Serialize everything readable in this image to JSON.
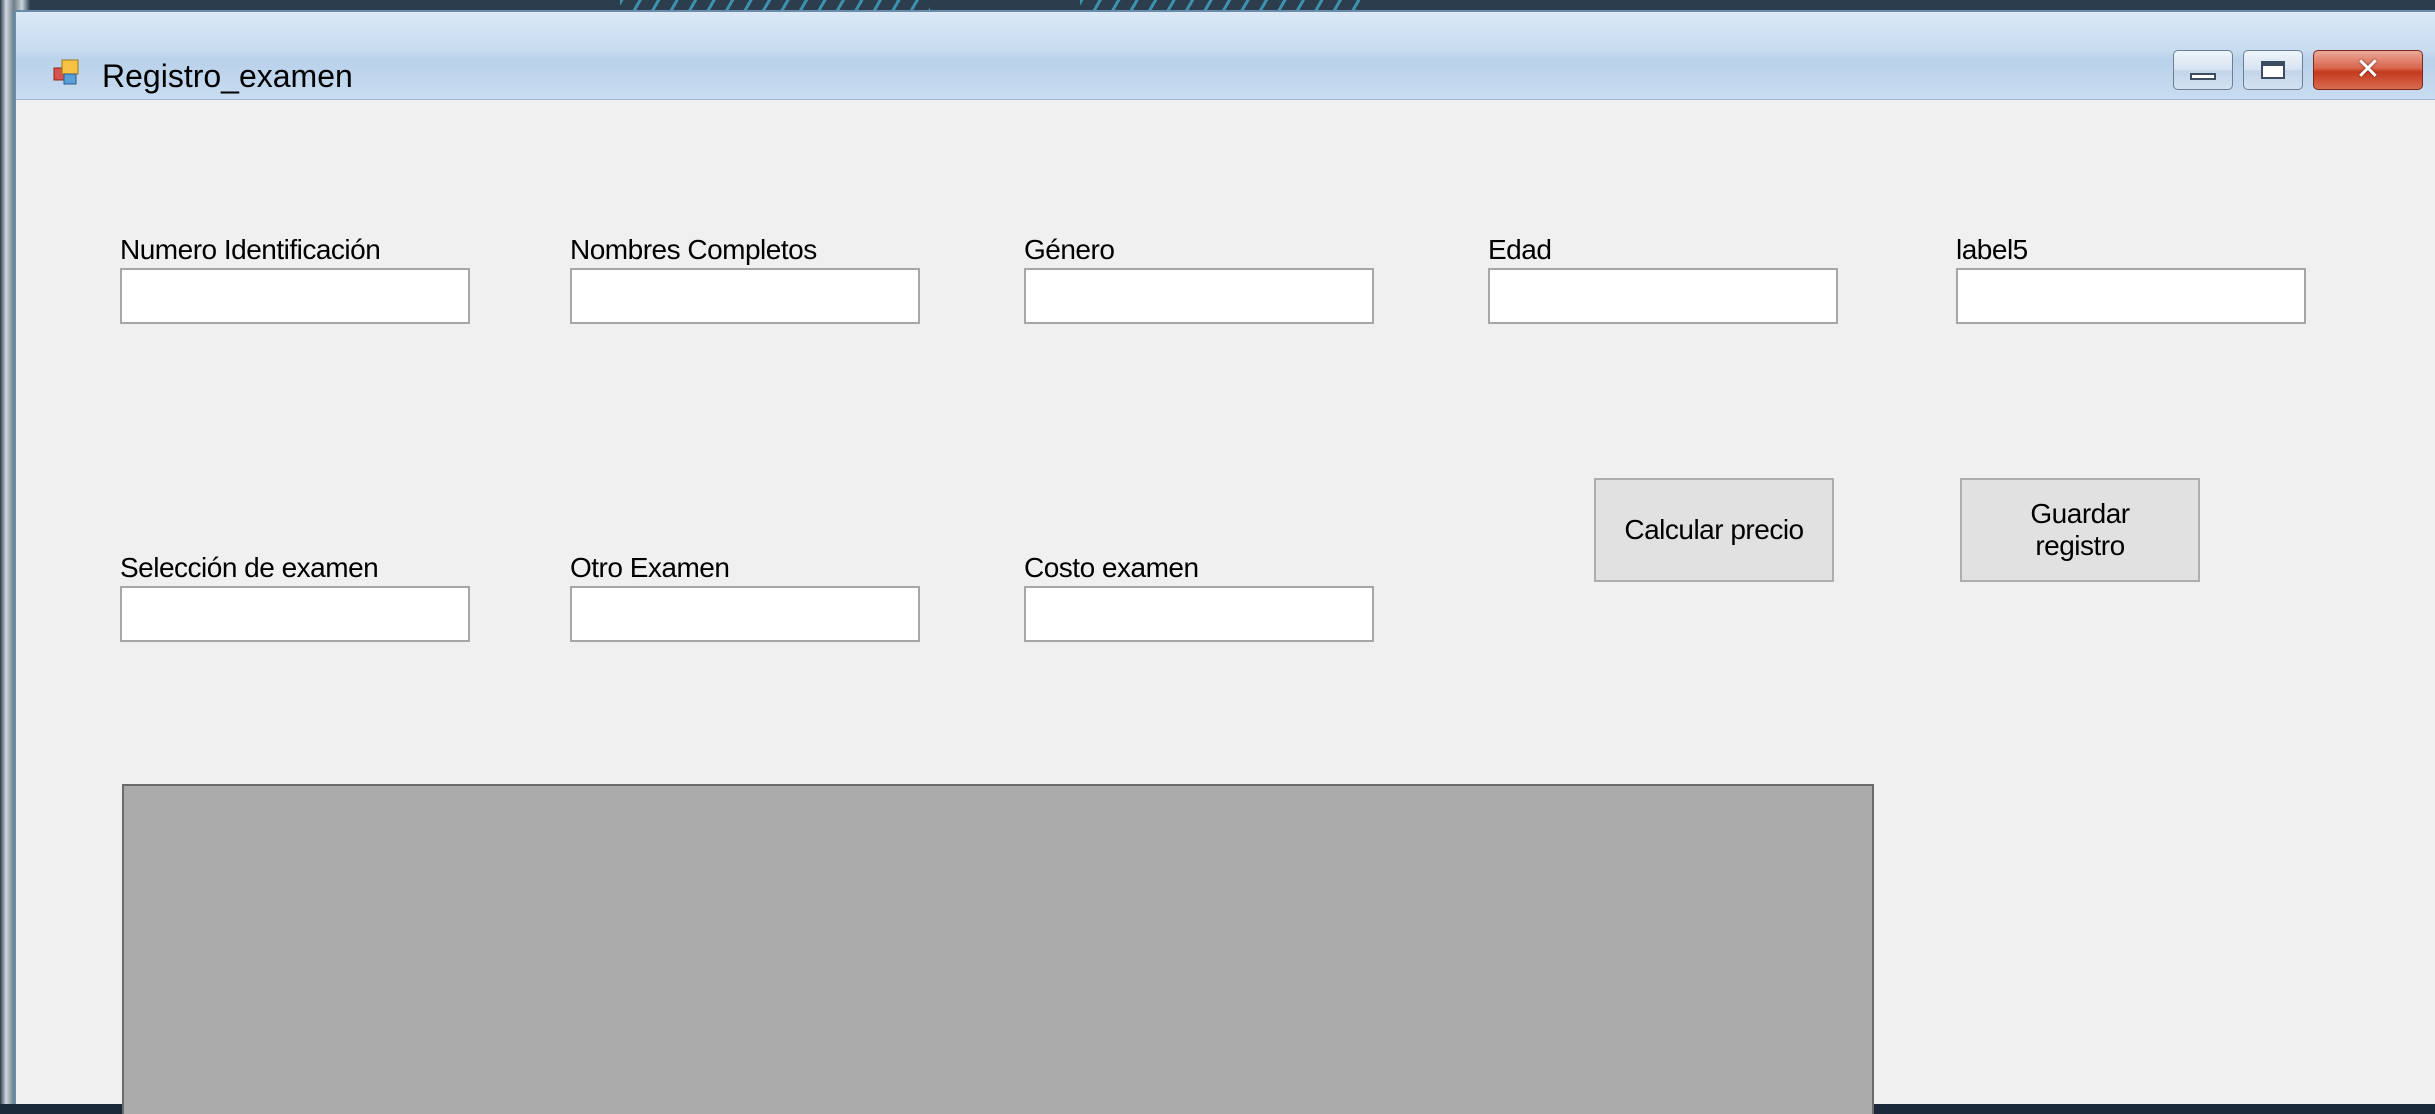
{
  "window": {
    "title": "Registro_examen"
  },
  "controls": {
    "minimize_icon": "minimize-icon",
    "maximize_icon": "maximize-icon",
    "close_icon": "close-icon",
    "close_glyph": "✕"
  },
  "form": {
    "row1": [
      {
        "id": "numero_identificacion",
        "label": "Numero Identificación",
        "value": ""
      },
      {
        "id": "nombres_completos",
        "label": "Nombres Completos",
        "value": ""
      },
      {
        "id": "genero",
        "label": "Género",
        "value": ""
      },
      {
        "id": "edad",
        "label": "Edad",
        "value": ""
      },
      {
        "id": "label5",
        "label": "label5",
        "value": ""
      }
    ],
    "row2": [
      {
        "id": "seleccion_examen",
        "label": "Selección de examen",
        "value": ""
      },
      {
        "id": "otro_examen",
        "label": "Otro Examen",
        "value": ""
      },
      {
        "id": "costo_examen",
        "label": "Costo examen",
        "value": ""
      }
    ],
    "buttons": {
      "calcular": "Calcular precio",
      "guardar_line1": "Guardar",
      "guardar_line2": "registro"
    }
  },
  "colors": {
    "window_bg": "#f0f0f0",
    "grid_bg": "#ababab",
    "close_button": "#c43a1e"
  }
}
